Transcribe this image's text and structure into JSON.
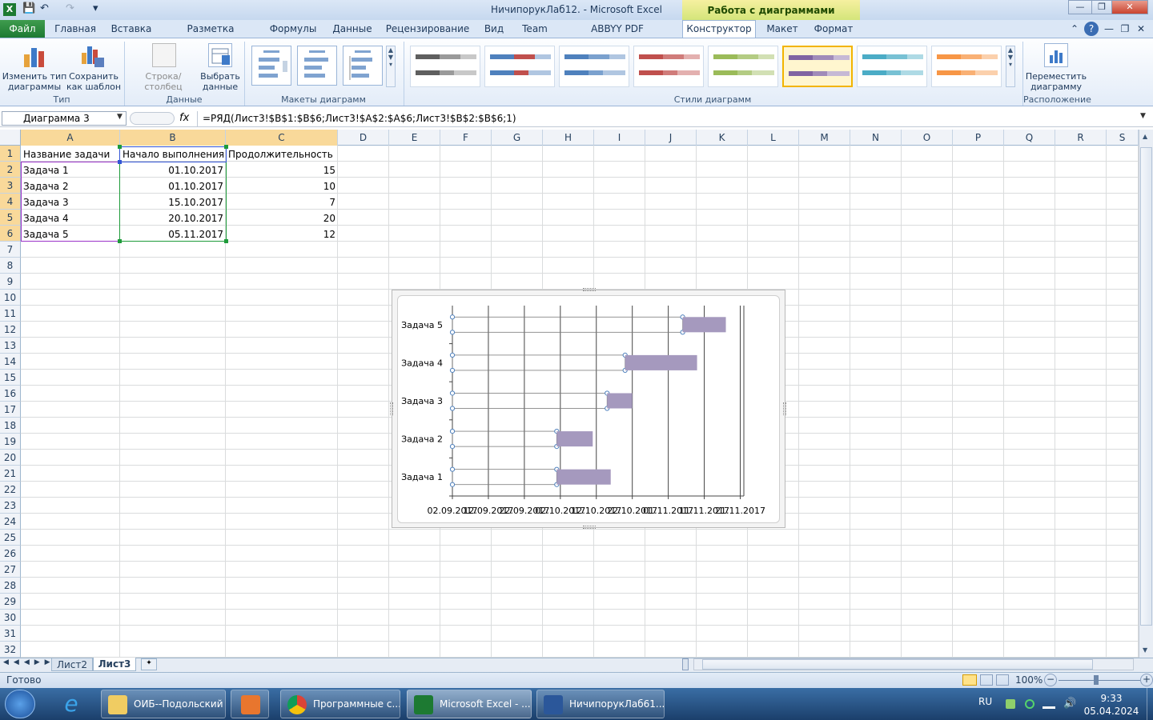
{
  "titlebar": {
    "title": "НичипорукЛаб12.  -  Microsoft Excel",
    "chart_tools": "Работа с диаграммами"
  },
  "tabs": {
    "file": "Файл",
    "items": [
      "Главная",
      "Вставка",
      "Разметка страницы",
      "Формулы",
      "Данные",
      "Рецензирование",
      "Вид",
      "Team",
      "ABBYY PDF Transformer+"
    ],
    "chart": [
      "Конструктор",
      "Макет",
      "Формат"
    ]
  },
  "ribbon": {
    "change_type": [
      "Изменить тип",
      "диаграммы"
    ],
    "save_template": [
      "Сохранить",
      "как шаблон"
    ],
    "row_col": "Строка/столбец",
    "select_data": [
      "Выбрать",
      "данные"
    ],
    "move_chart": [
      "Переместить",
      "диаграмму"
    ],
    "groups": {
      "type": "Тип",
      "data": "Данные",
      "layouts": "Макеты диаграмм",
      "styles": "Стили диаграмм",
      "location": "Расположение"
    },
    "style_colors": [
      "#5f5f5f",
      "#4f81bd",
      "#4f81bd",
      "#c0504d",
      "#9bbb59",
      "#8064a2",
      "#4bacc6",
      "#f79646"
    ]
  },
  "formula_bar": {
    "name_box": "Диаграмма 3",
    "fx": "fx",
    "formula": "=РЯД(Лист3!$B$1:$B$6;Лист3!$A$2:$A$6;Лист3!$B$2:$B$6;1)"
  },
  "columns": [
    "A",
    "B",
    "C",
    "D",
    "E",
    "F",
    "G",
    "H",
    "I",
    "J",
    "K",
    "L",
    "M",
    "N",
    "O",
    "P",
    "Q",
    "R",
    "S"
  ],
  "rows": [
    "1",
    "2",
    "3",
    "4",
    "5",
    "6",
    "7",
    "8",
    "9",
    "10",
    "11",
    "12",
    "13",
    "14",
    "15",
    "16",
    "17",
    "18",
    "19",
    "20",
    "21",
    "22",
    "23",
    "24",
    "25",
    "26",
    "27",
    "28",
    "29",
    "30",
    "31",
    "32"
  ],
  "table": {
    "headers": [
      "Название задачи",
      "Начало выполнения",
      "Продолжительность"
    ],
    "rows": [
      [
        "Задача 1",
        "01.10.2017",
        "15"
      ],
      [
        "Задача 2",
        "01.10.2017",
        "10"
      ],
      [
        "Задача 3",
        "15.10.2017",
        "7"
      ],
      [
        "Задача 4",
        "20.10.2017",
        "20"
      ],
      [
        "Задача 5",
        "05.11.2017",
        "12"
      ]
    ]
  },
  "chart_data": {
    "type": "bar",
    "orientation": "horizontal",
    "stacked": true,
    "categories": [
      "Задача 1",
      "Задача 2",
      "Задача 3",
      "Задача 4",
      "Задача 5"
    ],
    "series": [
      {
        "values": [
          "01.10.2017",
          "01.10.2017",
          "15.10.2017",
          "20.10.2017",
          "05.11.2017"
        ],
        "fill": "none",
        "selected": true
      },
      {
        "values": [
          15,
          10,
          7,
          20,
          12
        ],
        "color": "#a599be"
      }
    ],
    "x_ticks": [
      "02.09.2017",
      "12.09.2017",
      "22.09.2017",
      "02.10.2017",
      "12.10.2017",
      "22.10.2017",
      "01.11.2017",
      "11.11.2017",
      "21.11.2017"
    ],
    "xlim": [
      "02.09.2017",
      "22.11.2017"
    ],
    "grid": "vertical"
  },
  "sheets": {
    "tabs": [
      "Лист2",
      "Лист3"
    ],
    "active": "Лист3"
  },
  "status": {
    "ready": "Готово",
    "zoom": "100%"
  },
  "taskbar": {
    "buttons": [
      "ОИБ--Подольский",
      "Программные с...",
      "Microsoft Excel - ...",
      "НичипорукЛаб61..."
    ],
    "lang": "RU",
    "time": "9:33",
    "date": "05.04.2024"
  }
}
